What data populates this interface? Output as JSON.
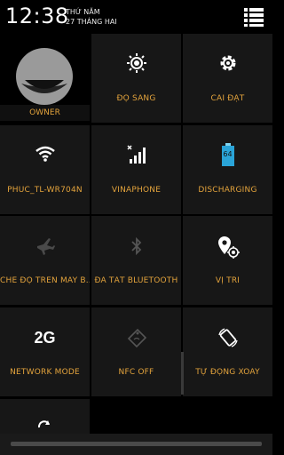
{
  "status_bar": {
    "time": "12:38",
    "weekday": "THỨ NĂM",
    "date": "27 THÁNG HAI",
    "menu_icon": "list-menu-icon"
  },
  "tiles": {
    "owner": {
      "label": "OWNER",
      "icon": "avatar-icon"
    },
    "brightness": {
      "label": "ĐỘ SÁNG",
      "icon": "brightness-icon"
    },
    "settings": {
      "label": "CÀI ĐẶT",
      "icon": "gear-icon"
    },
    "wifi": {
      "label": "PHUC_TL-WR704N",
      "icon": "wifi-icon"
    },
    "signal": {
      "label": "VINAPHONE",
      "icon": "signal-icon"
    },
    "battery": {
      "label": "DISCHARGING",
      "icon": "battery-icon",
      "level": "64"
    },
    "airplane": {
      "label": "CHẾ ĐỘ TRÊN MÁY B...",
      "icon": "airplane-icon"
    },
    "bluetooth": {
      "label": "ĐÃ TẮT BLUETOOTH",
      "icon": "bluetooth-icon"
    },
    "location": {
      "label": "VỊ TRÍ",
      "icon": "location-icon"
    },
    "network_mode": {
      "label": "NETWORK MODE",
      "icon": "2g-icon",
      "value": "2G"
    },
    "nfc": {
      "label": "NFC OFF",
      "icon": "nfc-icon"
    },
    "rotate": {
      "label": "TỰ ĐỘNG XOAY",
      "icon": "rotate-icon"
    },
    "sync": {
      "icon": "sync-icon"
    }
  },
  "colors": {
    "accent": "#e3a33c",
    "tile_bg": "#171717",
    "background": "#000000"
  }
}
